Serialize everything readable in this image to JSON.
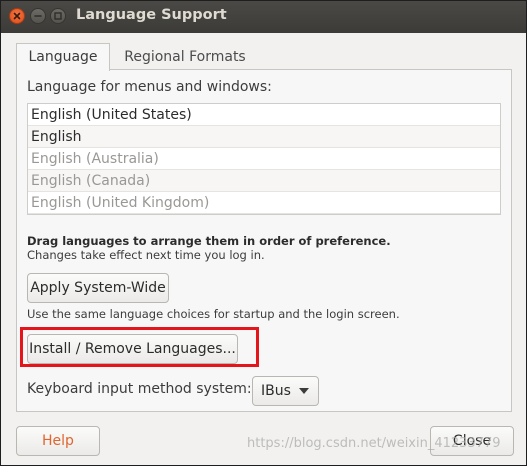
{
  "window": {
    "title": "Language Support",
    "controls": [
      "close-icon",
      "minimize-icon",
      "maximize-icon"
    ]
  },
  "tabs": [
    {
      "label": "Language",
      "active": true
    },
    {
      "label": "Regional Formats",
      "active": false
    }
  ],
  "language_section": {
    "label": "Language for menus and windows:",
    "languages": [
      {
        "label": "English (United States)",
        "enabled": true
      },
      {
        "label": "English",
        "enabled": true
      },
      {
        "label": "English (Australia)",
        "enabled": false
      },
      {
        "label": "English (Canada)",
        "enabled": false
      },
      {
        "label": "English (United Kingdom)",
        "enabled": false
      }
    ],
    "drag_hint": "Drag languages to arrange them in order of preference.",
    "login_hint": "Changes take effect next time you log in.",
    "apply_button": "Apply System-Wide",
    "system_wide_hint": "Use the same language choices for startup and the login screen.",
    "install_button": "Install / Remove Languages...",
    "keyboard_label": "Keyboard input method system:",
    "keyboard_value": "IBus"
  },
  "footer": {
    "help_button": "Help",
    "close_button": "Close"
  },
  "watermark": "https://blog.csdn.net/weixin_41233779",
  "colors": {
    "accent_orange": "#df4b16",
    "highlight_red": "#e4161c",
    "help_text": "#e0652f"
  }
}
